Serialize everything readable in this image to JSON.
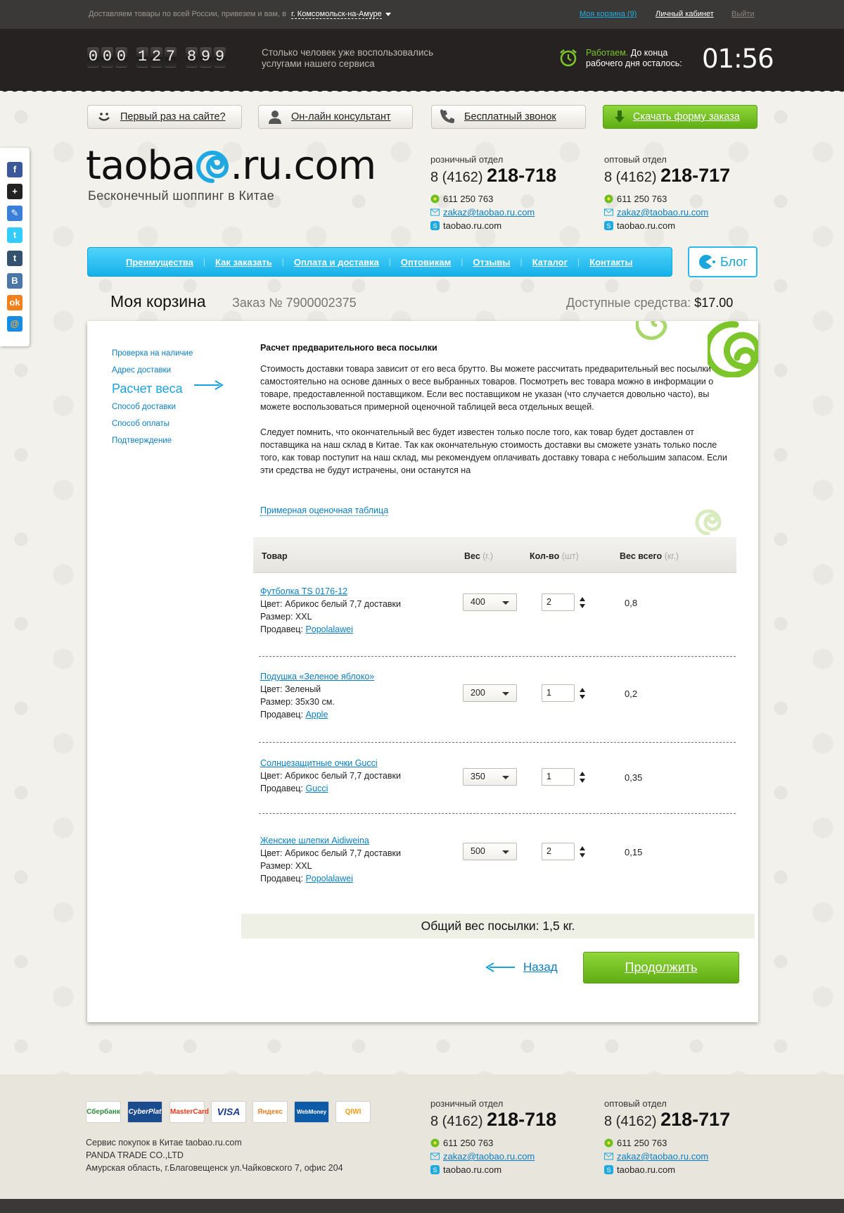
{
  "topbar": {
    "deliver_text": "Доставляем товары по всей России, привезем и вам, в",
    "city": "г. Комсомольск-на-Амуре",
    "cart_link": "Моя корзина (9)",
    "cabinet_link": "Личный кабинет",
    "logout_link": "Выйти"
  },
  "counter": {
    "digits": [
      "0",
      "0",
      "0",
      "1",
      "2",
      "7",
      "8",
      "9",
      "9"
    ],
    "text": "Столько человек уже воспользовались услугами нашего сервиса"
  },
  "worktime": {
    "status": "Работаем.",
    "text1": "До конца",
    "text2": "рабочего дня осталось:",
    "timer": "01:56"
  },
  "buttons": {
    "first_time": "Первый раз на сайте?",
    "consultant": "Он-лайн консультант",
    "free_call": "Бесплатный звонок",
    "download_form": "Скачать форму заказа"
  },
  "logo": {
    "part1": "taoba",
    "part2": ".ru.com",
    "slogan": "Бесконечный шоппинг в Китае"
  },
  "contacts": {
    "retail": {
      "label": "розничный отдел",
      "code": "8 (4162)",
      "number": "218-718",
      "icq": "611 250 763",
      "email": "zakaz@taobao.ru.com",
      "skype": "taobao.ru.com"
    },
    "wholesale": {
      "label": "оптовый отдел",
      "code": "8 (4162)",
      "number": "218-717",
      "icq": "611 250 763",
      "email": "zakaz@taobao.ru.com",
      "skype": "taobao.ru.com"
    }
  },
  "social": [
    "facebook-icon",
    "google-plus-icon",
    "delicious-icon",
    "twitter-icon",
    "tumblr-icon",
    "vkontakte-icon",
    "odnoklassniki-icon",
    "mail-ru-icon"
  ],
  "nav": {
    "items": [
      "Преимущества",
      "Как заказать",
      "Оплата и доставка",
      "Оптовикам",
      "Отзывы",
      "Каталог",
      "Контакты"
    ],
    "blog": "Блог"
  },
  "heading": {
    "title": "Моя корзина",
    "order": "Заказ № 7900002375",
    "funds_label": "Доступные средства:",
    "funds_value": "$17.00"
  },
  "steps": {
    "check": "Проверка на  наличие",
    "address": "Адрес доставки",
    "weight": "Расчет веса",
    "delivery": "Способ доставки",
    "payment": "Способ оплаты",
    "confirm": "Подтверждение"
  },
  "content": {
    "section_title": "Расчет предварительного веса посылки",
    "p1": "Стоимость доставки товара зависит от его веса брутто. Вы можете рассчитать предварительный вес посылки самостоятельно на основе данных о весе выбранных товаров. Посмотреть вес товара можно в информации о товаре, предоставленной поставщиком. Если вес поставщиком не указан (что случается довольно часто), вы можете воспользоваться примерной оценочной таблицей веса отдельных вещей.",
    "p2": "Следует помнить, что окончательный вес будет известен только после того, как товар будет доставлен от поставщика на наш склад в Китае. Так как окончательную стоимость доставки вы сможете узнать только после того, как товар поступит на наш склад, мы рекомендуем оплачивать доставку товара с небольшим запасом. Если эти средства не будут истрачены, они останутся на",
    "estimate_link": "Примерная оценочная таблица"
  },
  "table": {
    "headers": {
      "item": "Товар",
      "weight": "Вес",
      "weight_unit": "(г.)",
      "qty": "Кол-во",
      "qty_unit": "(шт)",
      "total": "Вес всего",
      "total_unit": "(кг.)"
    },
    "rows": [
      {
        "name": "Футболка TS 0176-12",
        "color": "Цвет: Абрикос белый 7,7 доставки",
        "size": "Размер: XXL",
        "seller_label": "Продавец:",
        "seller": "Popolalawei",
        "weight": "400",
        "qty": "2",
        "total": "0,8"
      },
      {
        "name": "Подушка «Зеленое яблоко»",
        "color": "Цвет: Зеленый",
        "size": "Размер: 35х30 см.",
        "seller_label": "Продавец:",
        "seller": "Apple",
        "weight": "200",
        "qty": "1",
        "total": "0,2"
      },
      {
        "name": "Солнцезащитные очки Gucci",
        "color": "Цвет: Абрикос белый 7,7 доставки",
        "size": "",
        "seller_label": "Продавец:",
        "seller": "Gucci",
        "weight": "350",
        "qty": "1",
        "total": "0,35"
      },
      {
        "name": "Женские шлепки Aidiweina ",
        "color": "Цвет: Абрикос белый 7,7 доставки",
        "size": "Размер: XXL",
        "seller_label": "Продавец:",
        "seller": "Popolalawei",
        "weight": "500",
        "qty": "2",
        "total": "0,15"
      }
    ]
  },
  "total": "Общий вес посылки: 1,5 кг.",
  "actions": {
    "back": "Назад",
    "continue": "Продолжить"
  },
  "footer": {
    "payments": [
      "Сбербанк",
      "CyberPlat",
      "MasterCard",
      "VISA",
      "Яндекс",
      "WebMoney",
      "QIWI"
    ],
    "line1": "Сервис покупок в Китае taobao.ru.com",
    "line2": "PANDA TRADE CO.,LTD",
    "line3": "Амурская область, г.Благовещенск ул.Чайковского 7, офис 204"
  },
  "colors": {
    "accent_blue": "#17b0ea",
    "accent_green": "#6cbf1f",
    "dark": "#252221"
  }
}
